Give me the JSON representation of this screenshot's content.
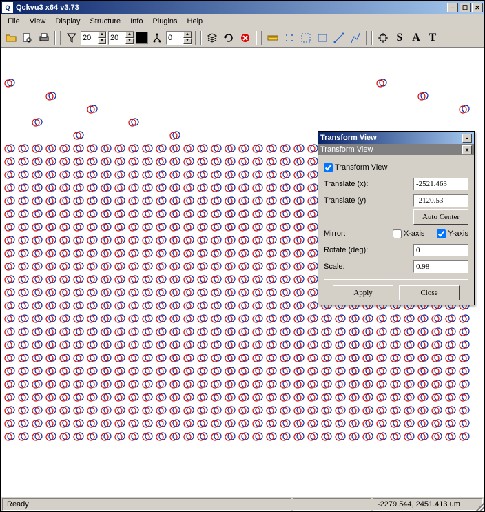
{
  "window": {
    "title": "Qckvu3 x64 v3.73"
  },
  "menubar": {
    "file": "File",
    "view": "View",
    "display": "Display",
    "structure": "Structure",
    "info": "Info",
    "plugins": "Plugins",
    "help": "Help"
  },
  "toolbar": {
    "spin1": "20",
    "spin2": "20",
    "spin3": "0"
  },
  "statusbar": {
    "ready": "Ready",
    "coords": "-2279.544, 2451.413 um"
  },
  "dialog": {
    "title": "Transform View",
    "subtitle": "Transform View",
    "checkbox_label": "Transform View",
    "translate_x_label": "Translate (x):",
    "translate_x_value": "-2521.463",
    "translate_y_label": "Translate (y)",
    "translate_y_value": "-2120.53",
    "auto_center_label": "Auto Center",
    "mirror_label": "Mirror:",
    "xaxis_label": "X-axis",
    "yaxis_label": "Y-axis",
    "rotate_label": "Rotate (deg):",
    "rotate_value": "0",
    "scale_label": "Scale:",
    "scale_value": "0.98",
    "apply_label": "Apply",
    "close_label": "Close"
  }
}
